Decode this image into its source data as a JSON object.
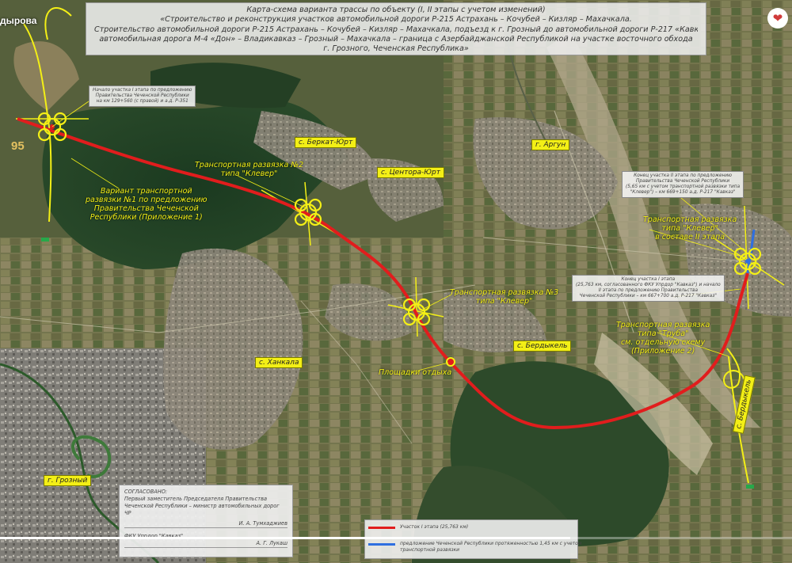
{
  "header": {
    "channel_label": "дырова",
    "title_lines": [
      "Карта-схема варианта трассы по объекту (I, II этапы с учетом изменений)",
      "«Строительство и реконструкция участков автомобильной дороги Р-215 Астрахань – Кочубей – Кизляр – Махачкала.",
      "Строительство автомобильной дороги Р-215 Астрахань – Кочубей – Кизляр – Махачкала, подъезд к г. Грозный до автомобильной дороги Р-217 «Кавказ»",
      "автомобильная дорога М-4 «Дон» – Владикавказ – Грозный – Махачкала – граница с Азербайджанской Республикой на участке восточного обхода",
      "г. Грозного, Чеченская Республика»"
    ]
  },
  "road_number": "95",
  "places": {
    "berkat_yurt": "с. Беркат-Юрт",
    "argun": "г. Аргун",
    "tsentora_yurt": "с. Центора-Юрт",
    "khankala": "с. Ханкала",
    "berdykel": "с. Бердыкель",
    "grozny": "г. Грозный",
    "mostnaya": "с. Бердыкель"
  },
  "callouts": {
    "interchange1": [
      "Вариант транспортной",
      "развязки №1 по предложению",
      "Правительства Чеченской",
      "Республики (Приложение 1)"
    ],
    "interchange2": [
      "Транспортная развязка №2",
      "типа \"Клевер\""
    ],
    "interchange3": [
      "Транспортная развязка №3",
      "типа \"Клевер\""
    ],
    "interchange_east": [
      "Транспортная развязка",
      "типа \"Клевер\"",
      "в составе II этапа"
    ],
    "interchange_truba": [
      "Транспортная развязка",
      "типа \"Труба\"",
      "см. отдельную схему",
      "(Приложение 2)"
    ],
    "rest_area": "Площадки отдыха"
  },
  "notes": {
    "start_note": [
      "Начало участка I этапа по предложению",
      "Правительства Чеченской Республики",
      "на км 129+560 (с правой) и а.д. Р-351"
    ],
    "end_ii_note": [
      "Конец участка II этапа по предложению",
      "Правительства Чеченской Республики",
      "(5,65 км с учетом транспортной развязки типа",
      "\"Клевер\") – км 669+150 а.д. Р-217 \"Кавказ\""
    ],
    "end_i_note": [
      "Конец участка I этапа",
      "(25,763 км, согласованного ФКУ Упрдор \"Кавказ\") и начало",
      "II этапа по предложению Правительства",
      "Чеченской Республики – км 667+700 а.д. Р-217 \"Кавказ\""
    ]
  },
  "approval": {
    "heading": "СОГЛАСОВАНО:",
    "line1": "Первый заместитель Председателя Правительства",
    "line2": "Чеченской Республики – министр автомобильных дорог ЧР",
    "sign1": "И. А. Тумхаджиев",
    "line3": "ФКУ Упрдор \"Кавказ\"",
    "sign2": "А. Г. Лукаш"
  },
  "legend": [
    {
      "label": "Участок I этапа (25,763 км)",
      "color": "#e11d1d"
    },
    {
      "label": "предложение Чеченской Республики протяженностью 1,45 км с учетом",
      "color": "#2f6fe0"
    },
    {
      "label": "транспортной развязки",
      "color": "#2f6fe0"
    }
  ],
  "colors": {
    "route": "#e11d1d",
    "interchange": "#f3ef16",
    "alt_route": "#2f6fe0"
  },
  "video_progress_fraction": 0.72,
  "icons": {
    "favorite": "heart-icon"
  }
}
